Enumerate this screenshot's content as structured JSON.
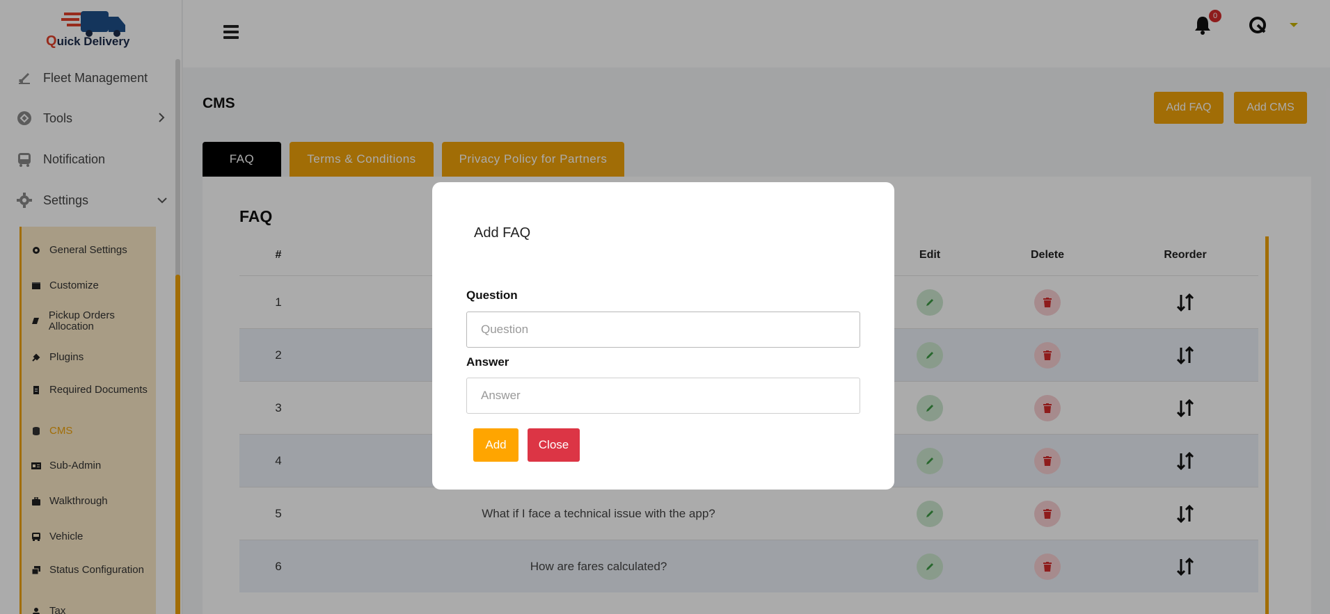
{
  "brand": {
    "logo_q": "Q",
    "logo_rest": "uick Delivery"
  },
  "sidebar": {
    "items": [
      {
        "label": "Fleet Management",
        "icon": "fleet-icon"
      },
      {
        "label": "Tools",
        "icon": "tools-icon"
      },
      {
        "label": "Notification",
        "icon": "notification-bus-icon"
      },
      {
        "label": "Settings",
        "icon": "gear-icon"
      }
    ],
    "submenu": [
      {
        "label": "General Settings",
        "icon": "gear-icon"
      },
      {
        "label": "Customize",
        "icon": "customize-icon"
      },
      {
        "label": "Pickup Orders Allocation",
        "icon": "book-icon"
      },
      {
        "label": "Plugins",
        "icon": "plug-icon"
      },
      {
        "label": "Required Documents",
        "icon": "document-icon"
      },
      {
        "label": "CMS",
        "icon": "database-icon",
        "active": true
      },
      {
        "label": "Sub-Admin",
        "icon": "id-card-icon"
      },
      {
        "label": "Walkthrough",
        "icon": "briefcase-icon"
      },
      {
        "label": "Vehicle",
        "icon": "bus-icon"
      },
      {
        "label": "Status Configuration",
        "icon": "layers-icon"
      },
      {
        "label": "Tax",
        "icon": "user-icon"
      }
    ]
  },
  "topbar": {
    "notification_count": "0"
  },
  "page": {
    "title": "CMS",
    "add_faq_label": "Add FAQ",
    "add_cms_label": "Add CMS"
  },
  "tabs": [
    {
      "label": "FAQ",
      "active": true
    },
    {
      "label": "Terms & Conditions",
      "active": false
    },
    {
      "label": "Privacy Policy for Partners",
      "active": false
    }
  ],
  "faq_table": {
    "heading": "FAQ",
    "columns": {
      "num": "#",
      "edit": "Edit",
      "delete": "Delete",
      "reorder": "Reorder"
    },
    "rows": [
      {
        "num": "1",
        "question": ""
      },
      {
        "num": "2",
        "question": ""
      },
      {
        "num": "3",
        "question": ""
      },
      {
        "num": "4",
        "question": ""
      },
      {
        "num": "5",
        "question": "What if I face a technical issue with the app?"
      },
      {
        "num": "6",
        "question": "How are fares calculated?"
      }
    ]
  },
  "modal": {
    "title": "Add FAQ",
    "question_label": "Question",
    "question_placeholder": "Question",
    "question_value": "",
    "answer_label": "Answer",
    "answer_placeholder": "Answer",
    "answer_value": "",
    "add_label": "Add",
    "close_label": "Close"
  },
  "colors": {
    "accent": "#f0a30a",
    "danger": "#dc3545",
    "dark": "#000000"
  }
}
